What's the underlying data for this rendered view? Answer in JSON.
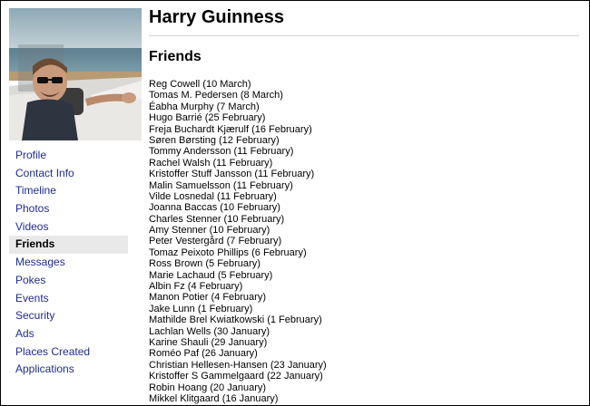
{
  "header": {
    "name": "Harry Guinness"
  },
  "sidebar": {
    "items": [
      {
        "label": "Profile",
        "active": false
      },
      {
        "label": "Contact Info",
        "active": false
      },
      {
        "label": "Timeline",
        "active": false
      },
      {
        "label": "Photos",
        "active": false
      },
      {
        "label": "Videos",
        "active": false
      },
      {
        "label": "Friends",
        "active": true
      },
      {
        "label": "Messages",
        "active": false
      },
      {
        "label": "Pokes",
        "active": false
      },
      {
        "label": "Events",
        "active": false
      },
      {
        "label": "Security",
        "active": false
      },
      {
        "label": "Ads",
        "active": false
      },
      {
        "label": "Places Created",
        "active": false
      },
      {
        "label": "Applications",
        "active": false
      }
    ]
  },
  "main": {
    "section_title": "Friends",
    "friends": [
      "Reg Cowell (10 March)",
      "Tomas M. Pedersen (8 March)",
      "Éabha Murphy (7 March)",
      "Hugo Barrié (25 February)",
      "Freja Buchardt Kjærulf (16 February)",
      "Søren Børsting (12 February)",
      "Tommy Andersson (11 February)",
      "Rachel Walsh (11 February)",
      "Kristoffer Stuff Jansson (11 February)",
      "Malin Samuelsson (11 February)",
      "Vilde Losnedal (11 February)",
      "Joanna Baccas (10 February)",
      "Charles Stenner (10 February)",
      "Amy Stenner (10 February)",
      "Peter Vestergård (7 February)",
      "Tomaz Peixoto Phillips (6 February)",
      "Ross Brown (5 February)",
      "Marie Lachaud (5 February)",
      "Albin Fz (4 February)",
      "Manon Potier (4 February)",
      "Jake Lunn (1 February)",
      "Mathilde Brel Kwiatkowski (1 February)",
      "Lachlan Wells (30 January)",
      "Karine Shauli (29 January)",
      "Roméo Paf (26 January)",
      "Christian Hellesen-Hansen (23 January)",
      "Kristoffer S Gammelgaard (22 January)",
      "Robin Hoang (20 January)",
      "Mikkel Klitgaard (16 January)"
    ]
  },
  "colors": {
    "link": "#1f2c8f",
    "active_background": "#e9e9e9",
    "divider": "#cfcfcf"
  },
  "icons": {
    "profile_photo": "profile-photo"
  }
}
